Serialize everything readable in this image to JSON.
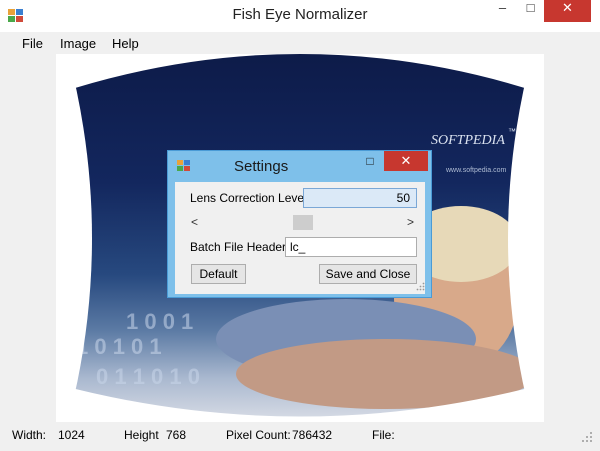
{
  "window": {
    "title": "Fish Eye Normalizer",
    "controls": {
      "minimize": "–",
      "maximize": "□",
      "close": "✕"
    }
  },
  "menu": {
    "items": [
      "File",
      "Image",
      "Help"
    ]
  },
  "image": {
    "watermark": "SOFTPEDIA",
    "watermark_tm": "™",
    "url_text": "www.softpedia.com"
  },
  "status": {
    "width_label": "Width:",
    "width_value": "1024",
    "height_label": "Height",
    "height_value": "768",
    "pixels_label": "Pixel Count:",
    "pixels_value": "786432",
    "file_label": "File:"
  },
  "settings": {
    "title": "Settings",
    "watermark": "SOFTPEDIA",
    "close": "✕",
    "maximize": "□",
    "lens_label": "Lens Correction Level",
    "lens_value": "50",
    "slider_level": 0.5,
    "slider_left": "<",
    "slider_right": ">",
    "batch_label": "Batch File Header",
    "batch_value": "lc_",
    "default_button": "Default",
    "save_button": "Save and Close"
  }
}
